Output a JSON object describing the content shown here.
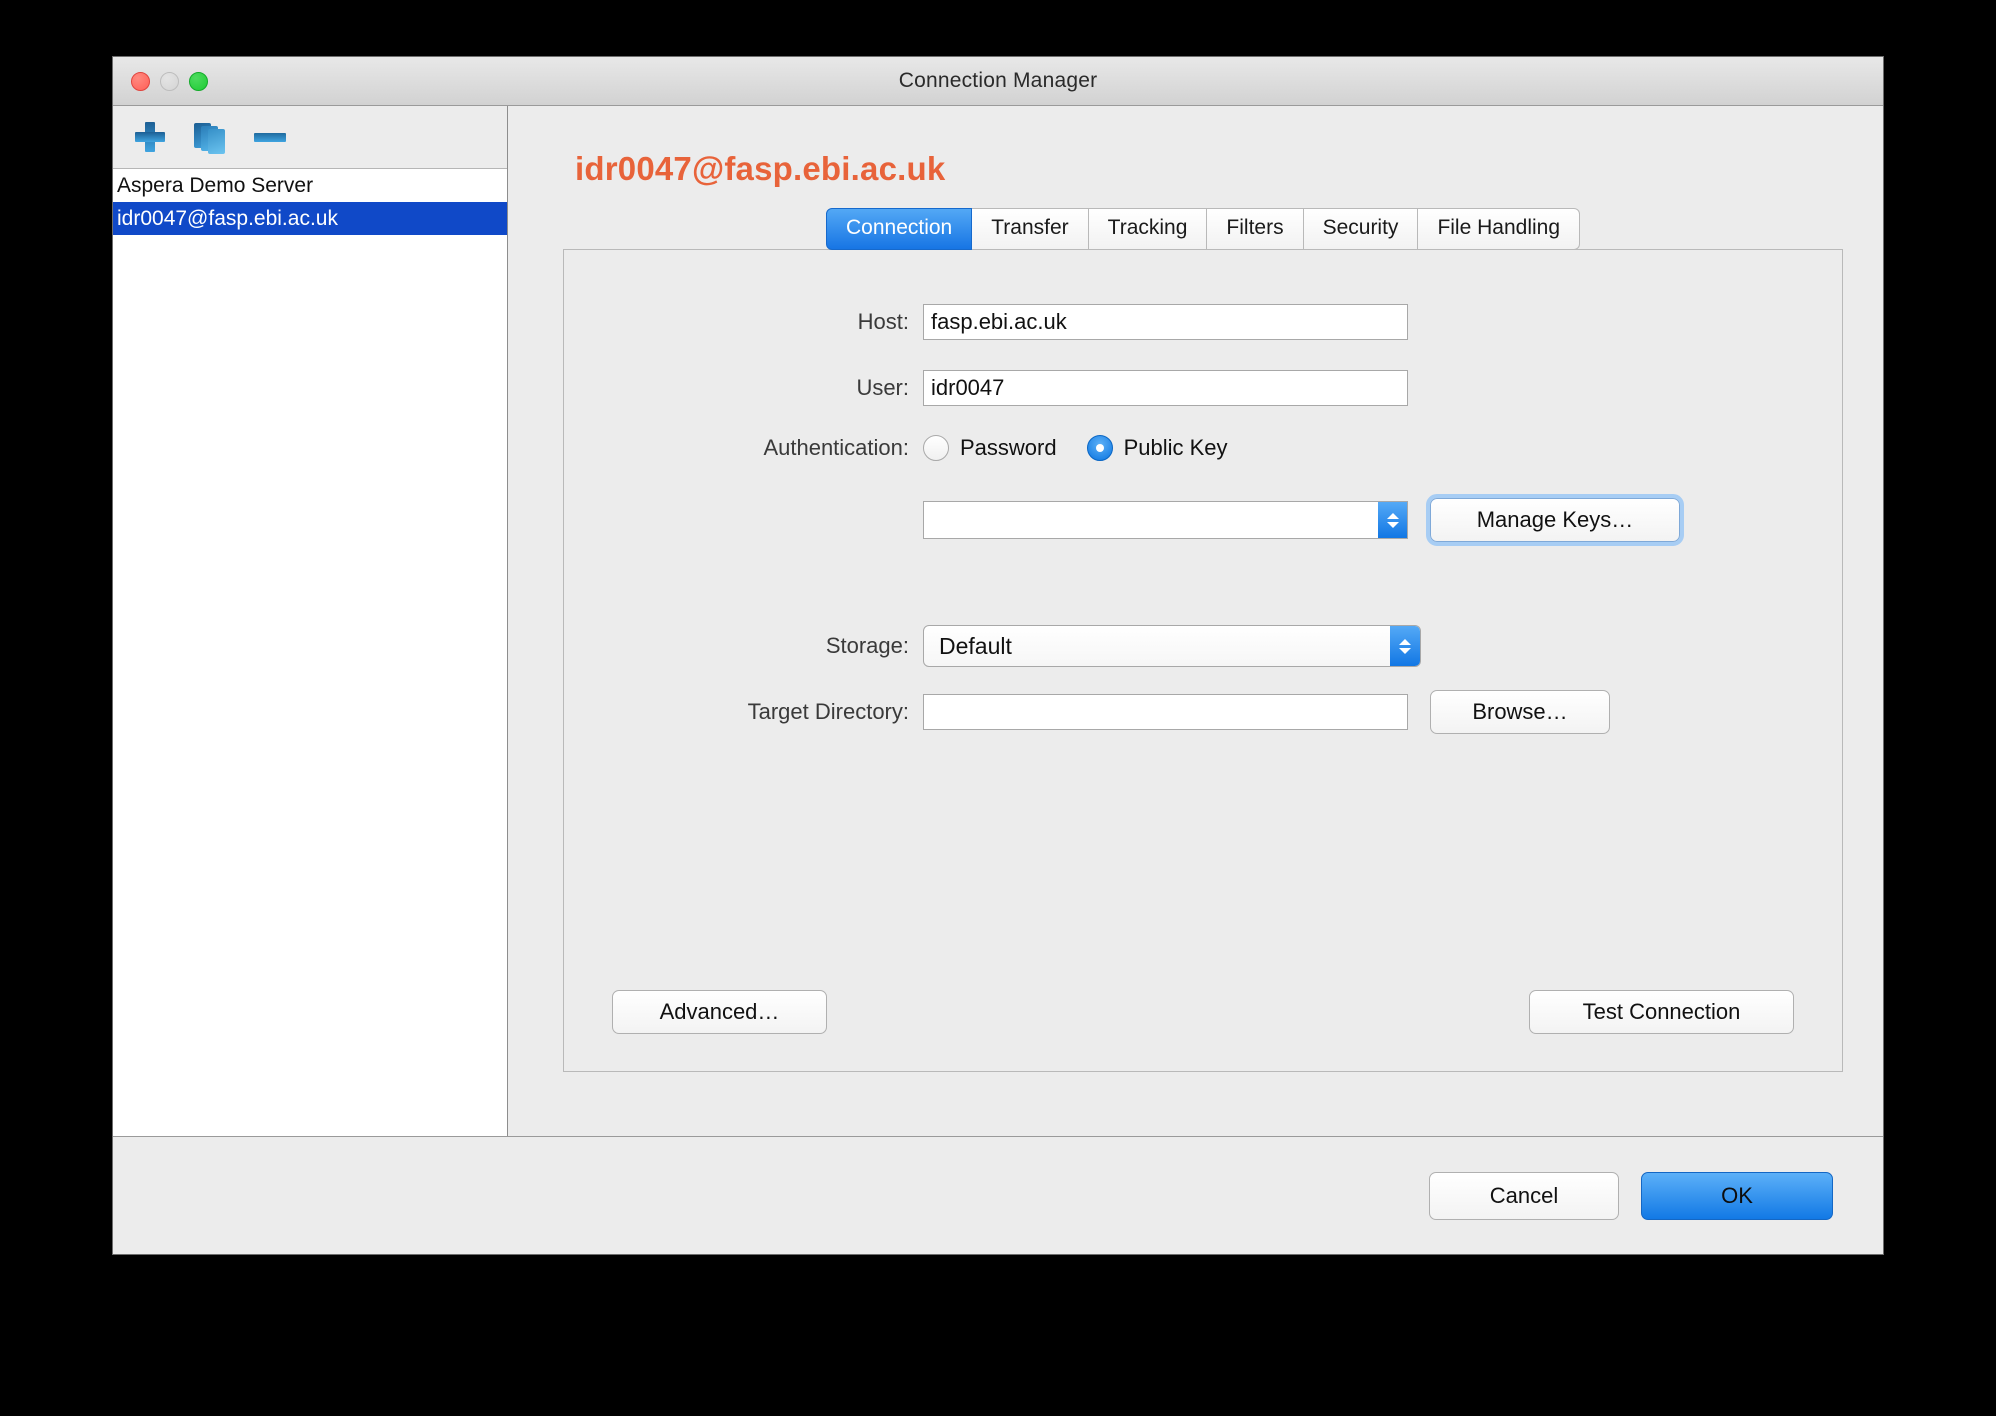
{
  "window": {
    "title": "Connection Manager",
    "traffic_lights": [
      "close-button",
      "minimize-button",
      "zoom-button"
    ]
  },
  "sidebar": {
    "toolbar": [
      {
        "name": "add-connection-button",
        "icon": "plus-icon"
      },
      {
        "name": "duplicate-connection-button",
        "icon": "duplicate-pages-icon"
      },
      {
        "name": "remove-connection-button",
        "icon": "minus-icon"
      }
    ],
    "items": [
      {
        "label": "Aspera Demo Server",
        "selected": false
      },
      {
        "label": "idr0047@fasp.ebi.ac.uk",
        "selected": true
      }
    ]
  },
  "content": {
    "heading": "idr0047@fasp.ebi.ac.uk",
    "heading_color": "#e8633a",
    "tabs": [
      {
        "label": "Connection",
        "active": true
      },
      {
        "label": "Transfer",
        "active": false
      },
      {
        "label": "Tracking",
        "active": false
      },
      {
        "label": "Filters",
        "active": false
      },
      {
        "label": "Security",
        "active": false
      },
      {
        "label": "File Handling",
        "active": false
      }
    ],
    "form": {
      "host_label": "Host:",
      "host_value": "fasp.ebi.ac.uk",
      "user_label": "User:",
      "user_value": "idr0047",
      "auth_label": "Authentication:",
      "auth_password_label": "Password",
      "auth_password_selected": false,
      "auth_publickey_label": "Public Key",
      "auth_publickey_selected": true,
      "key_select_value": "",
      "manage_keys_label": "Manage Keys…",
      "storage_label": "Storage:",
      "storage_value": "Default",
      "target_dir_label": "Target Directory:",
      "target_dir_value": "",
      "browse_label": "Browse…",
      "advanced_label": "Advanced…",
      "test_connection_label": "Test Connection"
    }
  },
  "footer": {
    "cancel_label": "Cancel",
    "ok_label": "OK",
    "ok_color": "#1279e5"
  }
}
